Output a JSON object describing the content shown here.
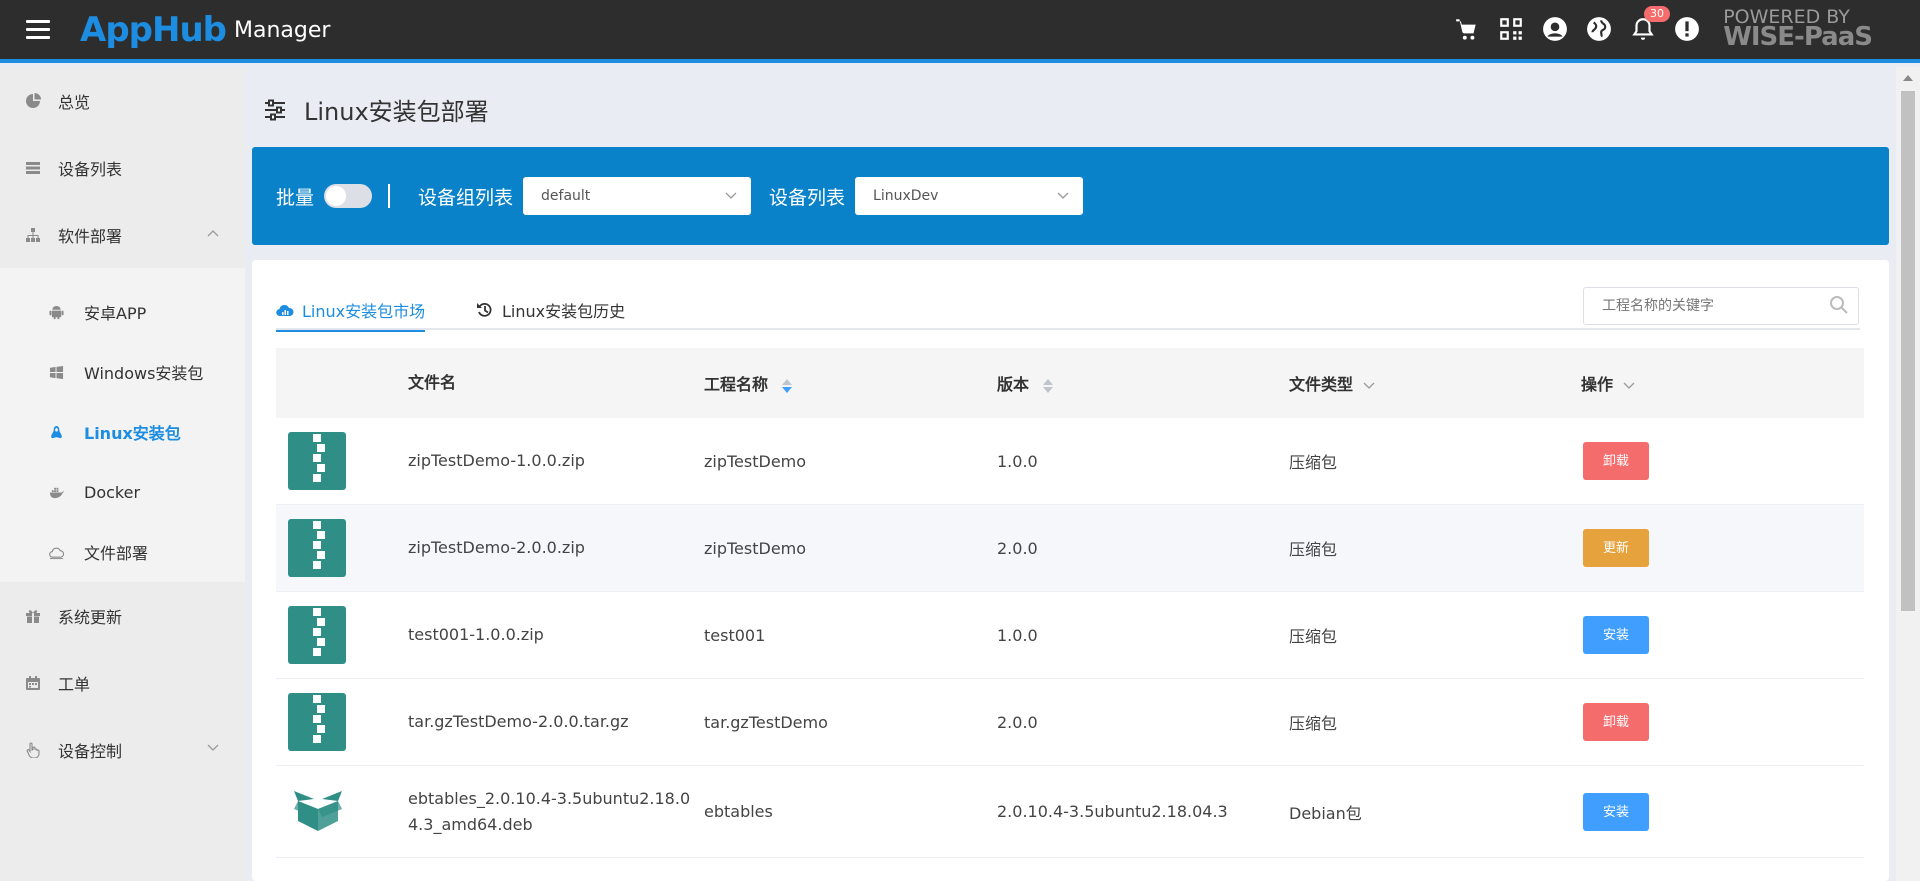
{
  "header": {
    "logo": "AppHub",
    "title": "Manager",
    "notifications_count": "30",
    "powered_line1": "POWERED BY",
    "powered_line2": "WISE-PaaS",
    "icons": [
      "cart-icon",
      "qrcode-icon",
      "user-icon",
      "globe-icon",
      "bell-icon",
      "alert-icon"
    ]
  },
  "sidebar": {
    "items": [
      {
        "label": "总览",
        "icon": "pie-chart-icon"
      },
      {
        "label": "设备列表",
        "icon": "server-list-icon"
      },
      {
        "label": "软件部署",
        "icon": "sitemap-icon",
        "expanded": true
      },
      {
        "label": "系统更新",
        "icon": "gift-icon"
      },
      {
        "label": "工单",
        "icon": "calendar-icon"
      },
      {
        "label": "设备控制",
        "icon": "hand-pointer-icon",
        "expanded": false
      }
    ],
    "sub_items": [
      {
        "label": "安卓APP",
        "icon": "android-icon"
      },
      {
        "label": "Windows安装包",
        "icon": "windows-icon"
      },
      {
        "label": "Linux安装包",
        "icon": "linux-icon",
        "active": true
      },
      {
        "label": "Docker",
        "icon": "docker-icon"
      },
      {
        "label": "文件部署",
        "icon": "cloud-icon"
      }
    ]
  },
  "page": {
    "title": "Linux安装包部署"
  },
  "filter": {
    "batch_label": "批量",
    "batch_on": false,
    "group_label": "设备组列表",
    "group_value": "default",
    "device_label": "设备列表",
    "device_value": "LinuxDev"
  },
  "tabs": [
    {
      "label": "Linux安装包市场",
      "active": true
    },
    {
      "label": "Linux安装包历史",
      "active": false
    }
  ],
  "search": {
    "placeholder": "工程名称的关键字"
  },
  "table": {
    "headers": {
      "filename": "文件名",
      "project": "工程名称",
      "version": "版本",
      "filetype": "文件类型",
      "action": "操作"
    },
    "rows": [
      {
        "filename": "zipTestDemo-1.0.0.zip",
        "project": "zipTestDemo",
        "version": "1.0.0",
        "filetype": "压缩包",
        "action": "卸载",
        "action_color": "red",
        "icon": "zip-file-icon"
      },
      {
        "filename": "zipTestDemo-2.0.0.zip",
        "project": "zipTestDemo",
        "version": "2.0.0",
        "filetype": "压缩包",
        "action": "更新",
        "action_color": "orange",
        "icon": "zip-file-icon"
      },
      {
        "filename": "test001-1.0.0.zip",
        "project": "test001",
        "version": "1.0.0",
        "filetype": "压缩包",
        "action": "安装",
        "action_color": "blue",
        "icon": "zip-file-icon"
      },
      {
        "filename": "tar.gzTestDemo-2.0.0.tar.gz",
        "project": "tar.gzTestDemo",
        "version": "2.0.0",
        "filetype": "压缩包",
        "action": "卸载",
        "action_color": "red",
        "icon": "zip-file-icon"
      },
      {
        "filename": "ebtables_2.0.10.4-3.5ubuntu2.18.04.3_amd64.deb",
        "filename_line1": "ebtables_2.0.10.4-3.5ubuntu2.18.0",
        "filename_line2": "4.3_amd64.deb",
        "project": "ebtables",
        "version": "2.0.10.4-3.5ubuntu2.18.04.3",
        "filetype": "Debian包",
        "action": "安装",
        "action_color": "blue",
        "icon": "package-box-icon"
      }
    ]
  },
  "colors": {
    "topbar": "#2d2d2d",
    "brand": "#1c8de0",
    "filterbar": "#0a82ca",
    "btn_red": "#f56c6c",
    "btn_orange": "#e6a23c",
    "btn_blue": "#409eff",
    "file_icon": "#2f8f86"
  }
}
